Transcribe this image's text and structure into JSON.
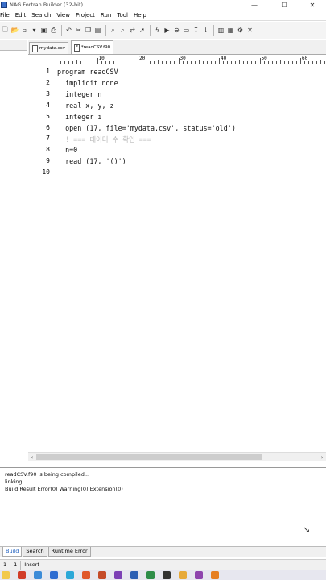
{
  "window": {
    "title": "NAG Fortran Builder (32-bit)",
    "controls": {
      "minimize": "—",
      "maximize": "☐",
      "close": "✕"
    }
  },
  "menu": [
    "File",
    "Edit",
    "Search",
    "View",
    "Project",
    "Run",
    "Tool",
    "Help"
  ],
  "toolbar": {
    "buttons": [
      "new-file-icon",
      "open-folder-icon",
      "new-icon",
      "open-icon",
      "save-icon",
      "print-icon",
      "undo-icon",
      "cut-icon",
      "copy-icon",
      "paste-icon",
      "find-icon",
      "find-next-icon",
      "replace-icon",
      "goto-icon",
      "build-icon",
      "run-icon",
      "stop-icon",
      "debug-icon",
      "step-icon",
      "step-over-icon",
      "panel-icon",
      "window-icon",
      "settings-icon",
      "close-icon"
    ]
  },
  "tabs": [
    {
      "label": "mydata.csv",
      "active": false
    },
    {
      "label": "*readCSV.f90",
      "active": true
    }
  ],
  "ruler": {
    "labels": [
      "10",
      "20",
      "30",
      "40",
      "50",
      "60"
    ]
  },
  "editor": {
    "line_numbers": [
      "1",
      "2",
      "3",
      "4",
      "5",
      "6",
      "7",
      "8",
      "9",
      "10"
    ],
    "lines": [
      {
        "text": "program readCSV",
        "comment": false
      },
      {
        "text": "  implicit none",
        "comment": false
      },
      {
        "text": "  integer n",
        "comment": false
      },
      {
        "text": "  real x, y, z",
        "comment": false
      },
      {
        "text": "  integer i",
        "comment": false
      },
      {
        "text": "  open (17, file='mydata.csv', status='old')",
        "comment": false
      },
      {
        "text": "  ! === 데이터 수 확인 ===",
        "comment": true
      },
      {
        "text": "  n=0",
        "comment": false
      },
      {
        "text": "  read (17, '()')",
        "comment": false
      },
      {
        "text": "",
        "comment": false
      }
    ]
  },
  "output": {
    "lines": [
      "readCSV.f90 is being compiled...",
      "linking...",
      "Build Result Error(0) Warning(0) Extension(0)"
    ]
  },
  "output_tabs": [
    {
      "label": "Build",
      "active": true
    },
    {
      "label": "Search",
      "active": false
    },
    {
      "label": "Runtime Error",
      "active": false
    }
  ],
  "status": {
    "line": "1",
    "col": "1",
    "mode": "Insert"
  },
  "taskbar": {
    "icons": [
      {
        "name": "file-explorer-icon",
        "color": "#f2c94c"
      },
      {
        "name": "browser-icon",
        "color": "#d13b2a"
      },
      {
        "name": "mail-icon",
        "color": "#3c8ad8"
      },
      {
        "name": "store-icon",
        "color": "#2f6bd1"
      },
      {
        "name": "photos-icon",
        "color": "#2aa6d8"
      },
      {
        "name": "office-icon",
        "color": "#e0572b"
      },
      {
        "name": "powerpoint-icon",
        "color": "#c44a2a"
      },
      {
        "name": "onenote-icon",
        "color": "#7b3fb5"
      },
      {
        "name": "word-icon",
        "color": "#2d5fb4"
      },
      {
        "name": "excel-icon",
        "color": "#2d8c4a"
      },
      {
        "name": "terminal-icon",
        "color": "#333333"
      },
      {
        "name": "folder-icon",
        "color": "#e7a93a"
      },
      {
        "name": "app-icon",
        "color": "#8e44ad"
      },
      {
        "name": "app2-icon",
        "color": "#e67e22"
      }
    ]
  }
}
